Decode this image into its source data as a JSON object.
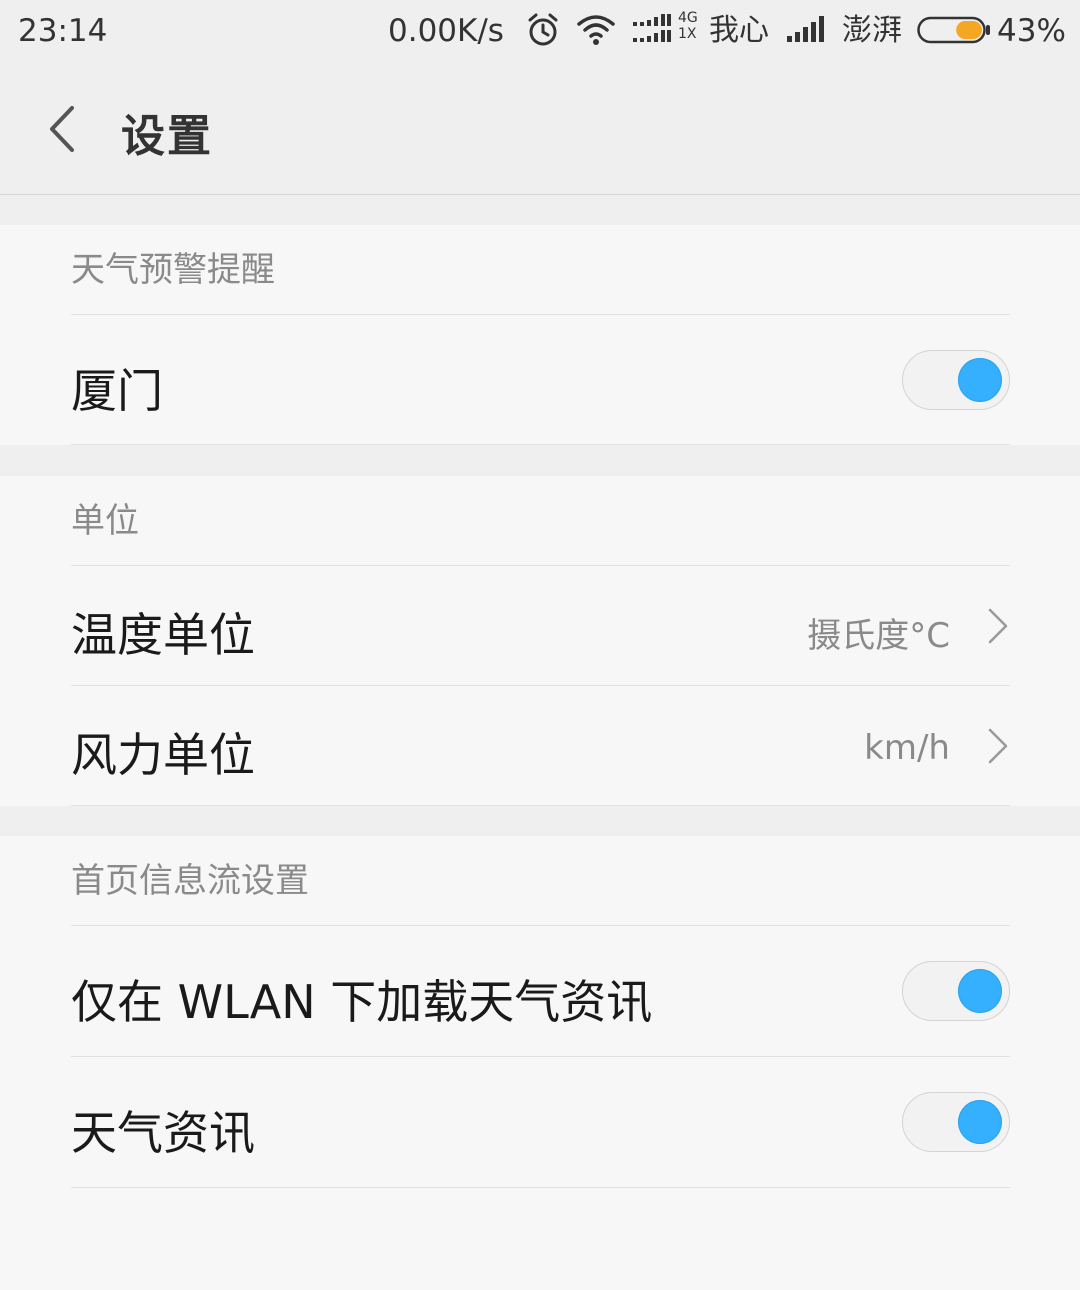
{
  "status_bar": {
    "time": "23:14",
    "net_speed": "0.00K/s",
    "alarm_icon": "alarm-icon",
    "wifi_icon": "wifi-icon",
    "network_top": "4G",
    "network_bottom": "1X",
    "carrier1": "我心",
    "carrier2": "澎湃",
    "battery_percent": "43%",
    "battery_level": 0.43,
    "battery_color": "#f5a623"
  },
  "header": {
    "back_icon": "chevron-left-icon",
    "title": "设置"
  },
  "sections": [
    {
      "title": "天气预警提醒",
      "rows": [
        {
          "label": "厦门",
          "type": "toggle",
          "on": true
        }
      ]
    },
    {
      "title": "单位",
      "rows": [
        {
          "label": "温度单位",
          "type": "value",
          "value": "摄氏度°C"
        },
        {
          "label": "风力单位",
          "type": "value",
          "value": "km/h"
        }
      ]
    },
    {
      "title": "首页信息流设置",
      "rows": [
        {
          "label": "仅在 WLAN 下加载天气资讯",
          "type": "toggle",
          "on": true
        },
        {
          "label": "天气资讯",
          "type": "toggle",
          "on": true
        }
      ]
    }
  ],
  "colors": {
    "toggle_on": "#34b0ff",
    "background": "#efefef",
    "section_bg": "#f7f7f7"
  }
}
